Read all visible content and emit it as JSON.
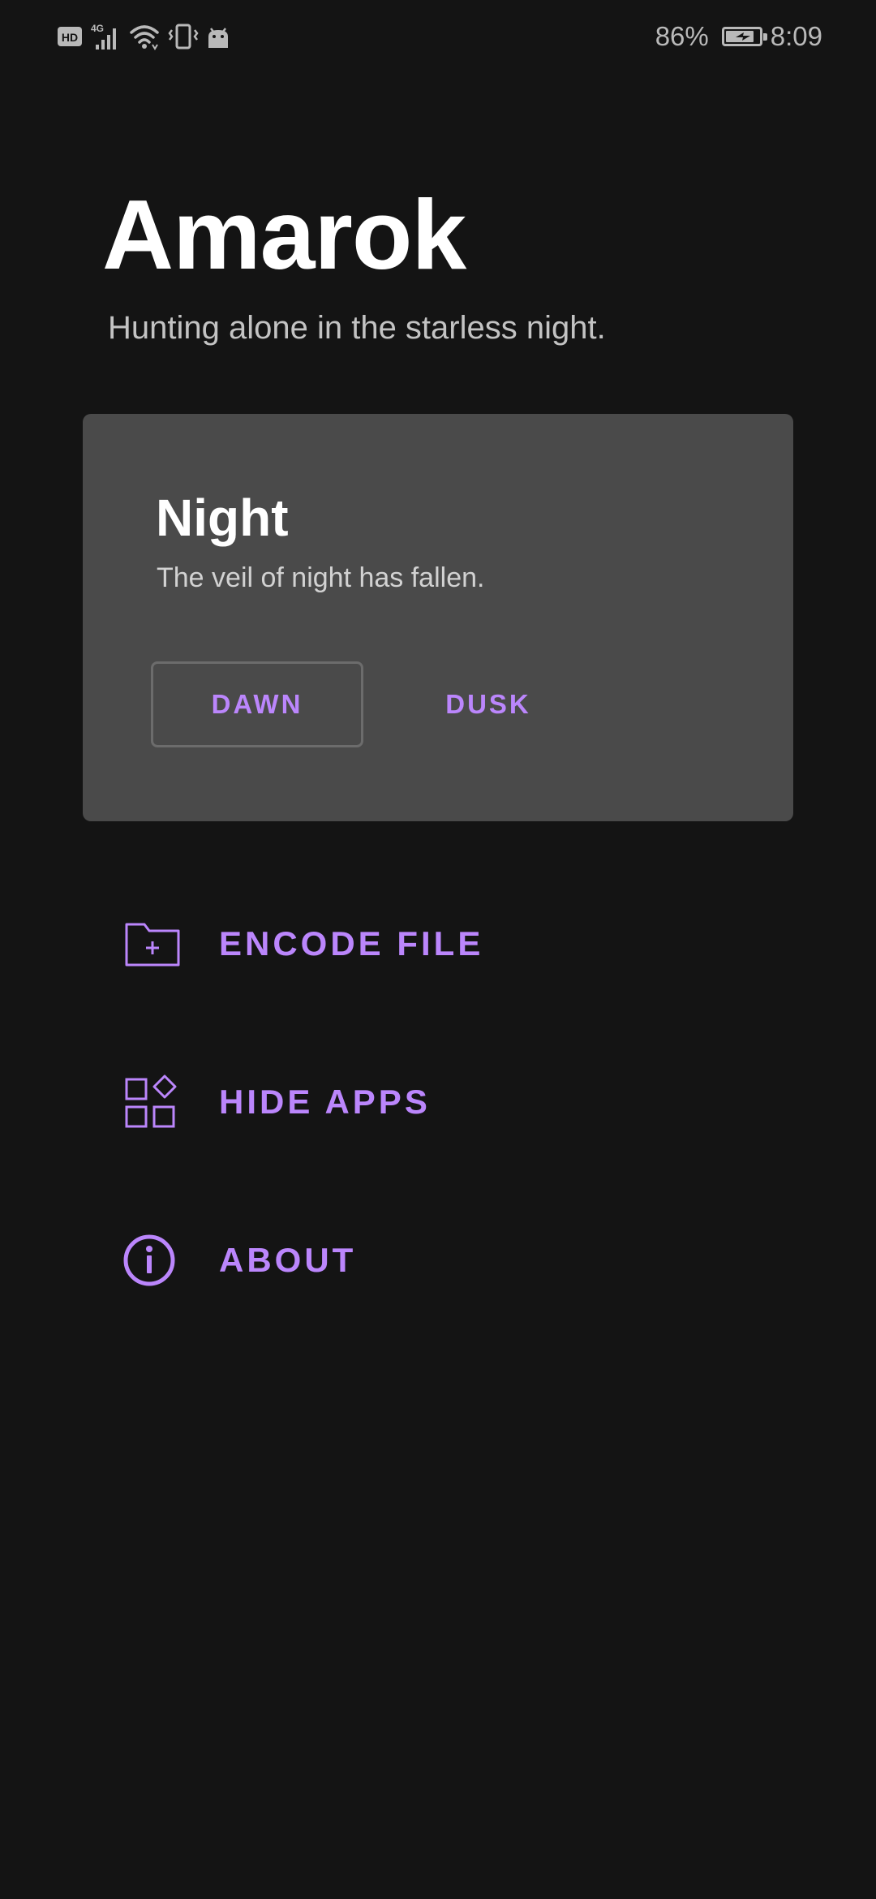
{
  "status_bar": {
    "hd_badge": "HD",
    "network_type": "4G",
    "battery_percent": "86%",
    "battery_level": 0.86,
    "time": "8:09",
    "icons": [
      "hd-badge-icon",
      "signal-icon",
      "wifi-icon",
      "vibrate-icon",
      "android-icon",
      "battery-icon"
    ]
  },
  "header": {
    "title": "Amarok",
    "subtitle": "Hunting alone in the starless night."
  },
  "mode_card": {
    "title": "Night",
    "subtitle": "The veil of night has fallen.",
    "dawn_label": "DAWN",
    "dusk_label": "DUSK"
  },
  "menu": {
    "items": [
      {
        "label": "ENCODE FILE",
        "icon": "folder-add-icon"
      },
      {
        "label": "HIDE APPS",
        "icon": "apps-grid-icon"
      },
      {
        "label": "ABOUT",
        "icon": "info-icon"
      }
    ]
  },
  "colors": {
    "background": "#141414",
    "card": "#4a4a4a",
    "accent": "#bb86fc",
    "text_primary": "#ffffff",
    "text_secondary": "#c3c3c3"
  }
}
